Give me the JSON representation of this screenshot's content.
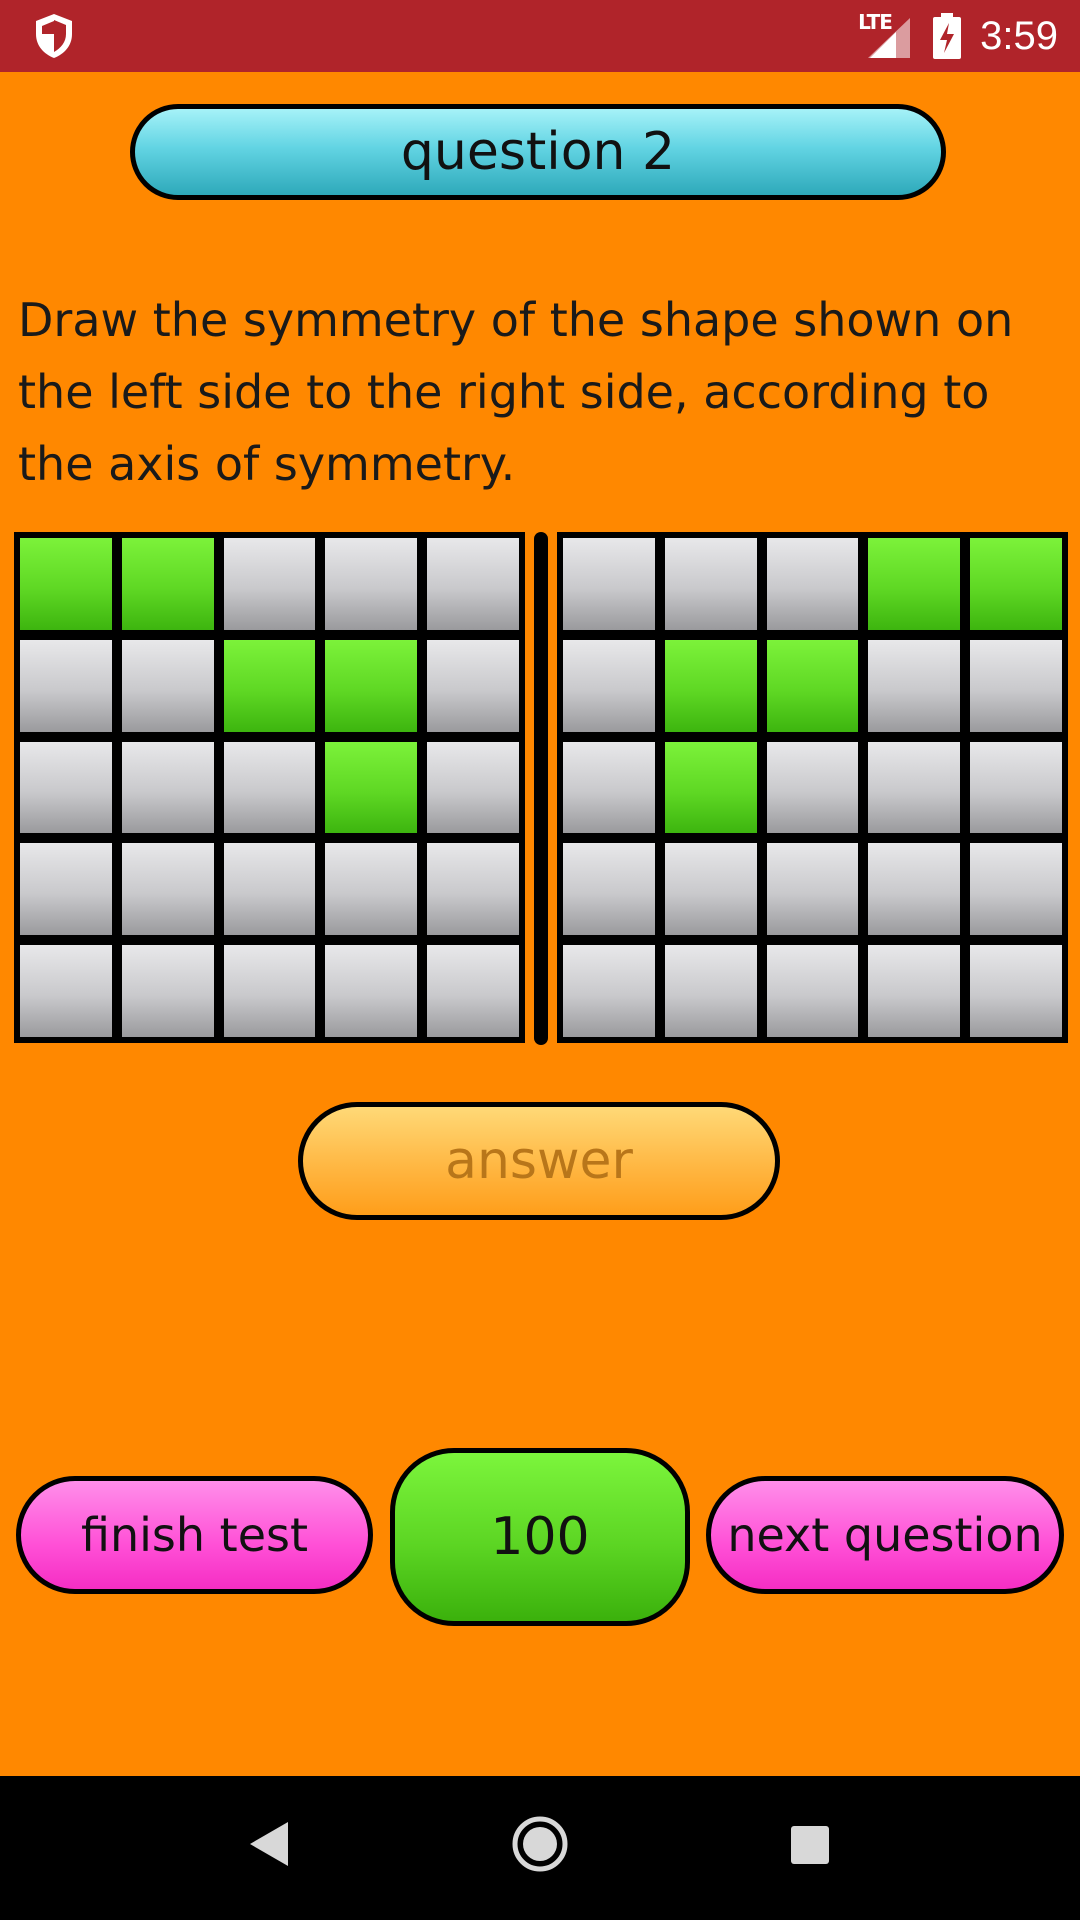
{
  "status_bar": {
    "network_label": "LTE",
    "time": "3:59",
    "icons": [
      "shield-icon",
      "signal-icon",
      "battery-charging-icon"
    ]
  },
  "quiz": {
    "title": "question 2",
    "instructions": "Draw the symmetry of the shape shown on the left side to the right side, according to the axis of symmetry.",
    "left_grid": [
      [
        1,
        1,
        0,
        0,
        0
      ],
      [
        0,
        0,
        1,
        1,
        0
      ],
      [
        0,
        0,
        0,
        1,
        0
      ],
      [
        0,
        0,
        0,
        0,
        0
      ],
      [
        0,
        0,
        0,
        0,
        0
      ]
    ],
    "right_grid": [
      [
        0,
        0,
        0,
        1,
        1
      ],
      [
        0,
        1,
        1,
        0,
        0
      ],
      [
        0,
        1,
        0,
        0,
        0
      ],
      [
        0,
        0,
        0,
        0,
        0
      ],
      [
        0,
        0,
        0,
        0,
        0
      ]
    ],
    "answer_label": "answer",
    "finish_label": "finish test",
    "score": "100",
    "next_label": "next question"
  },
  "colors": {
    "status_bar": "#B0242A",
    "background": "#FF8800",
    "cell_on": "#5FD824",
    "cell_off": "#C9C9CC",
    "pink_button": "#FF4FD6",
    "score_box": "#5CD523",
    "title_pill": "#62D4E3"
  },
  "nav_bar": {
    "icons": [
      "back-icon",
      "home-icon",
      "recents-icon"
    ]
  }
}
